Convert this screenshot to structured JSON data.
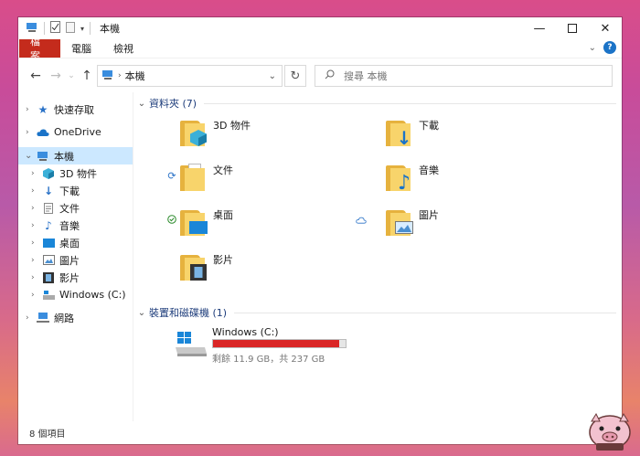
{
  "window": {
    "title": "本機"
  },
  "ribbon": {
    "tabs": [
      "檔案",
      "電腦",
      "檢視"
    ]
  },
  "address": {
    "path": "本機"
  },
  "search": {
    "placeholder": "搜尋 本機"
  },
  "sidebar": {
    "quick_access": "快速存取",
    "onedrive": "OneDrive",
    "this_pc": "本機",
    "children": [
      "3D 物件",
      "下載",
      "文件",
      "音樂",
      "桌面",
      "圖片",
      "影片",
      "Windows (C:)"
    ],
    "network": "網路"
  },
  "content": {
    "folders_group": "資料夾 (7)",
    "folders": [
      "3D 物件",
      "下載",
      "文件",
      "音樂",
      "桌面",
      "圖片",
      "影片"
    ],
    "drives_group": "裝置和磁碟機 (1)",
    "drive": {
      "name": "Windows (C:)",
      "free_text": "剩餘 11.9 GB，共 237 GB",
      "used_fraction": 0.95
    }
  },
  "status": {
    "items": "8 個項目"
  },
  "colors": {
    "accent": "#c42b1c",
    "selection": "#cce8ff",
    "drive_bar": "#da2626"
  }
}
